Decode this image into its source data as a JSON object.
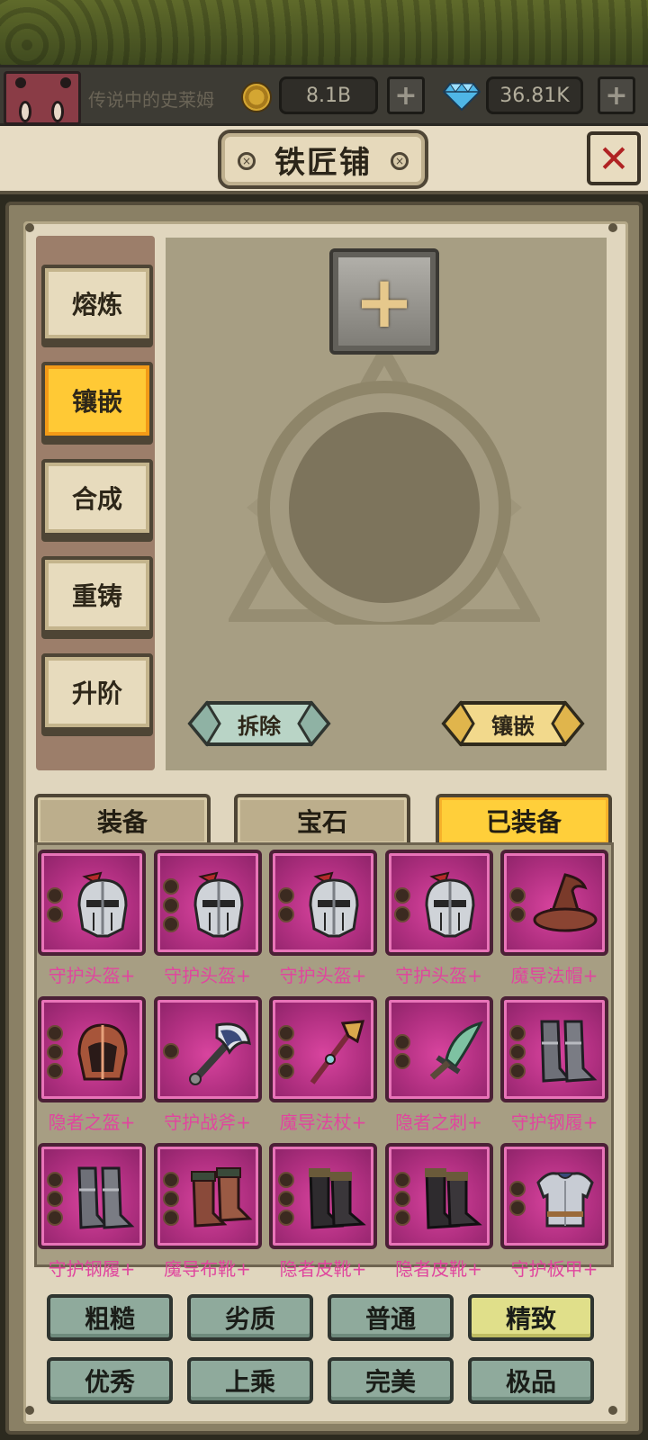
{
  "player": {
    "name": "传说中的史莱姆",
    "gold": "8.1B",
    "gems": "36.81K",
    "add_label": "+"
  },
  "header": {
    "title": "铁匠铺",
    "close_label": "✕"
  },
  "side_tabs": [
    {
      "label": "熔炼",
      "active": false
    },
    {
      "label": "镶嵌",
      "active": true
    },
    {
      "label": "合成",
      "active": false
    },
    {
      "label": "重铸",
      "active": false
    },
    {
      "label": "升阶",
      "active": false
    }
  ],
  "socket": {
    "add_slot_label": "+",
    "remove_button": "拆除",
    "inlay_button": "镶嵌"
  },
  "category_tabs": [
    {
      "label": "装备",
      "active": false
    },
    {
      "label": "宝石",
      "active": false
    },
    {
      "label": "已装备",
      "active": true
    }
  ],
  "items": [
    {
      "name": "守护头盔+",
      "icon": "helmet-icon",
      "sockets": 2
    },
    {
      "name": "守护头盔+",
      "icon": "helmet-icon",
      "sockets": 3
    },
    {
      "name": "守护头盔+",
      "icon": "helmet-icon",
      "sockets": 2
    },
    {
      "name": "守护头盔+",
      "icon": "helmet-icon",
      "sockets": 2
    },
    {
      "name": "魔导法帽+",
      "icon": "wizard-hat-icon",
      "sockets": 2
    },
    {
      "name": "隐者之盔+",
      "icon": "hood-helmet-icon",
      "sockets": 3
    },
    {
      "name": "守护战斧+",
      "icon": "battle-axe-icon",
      "sockets": 1
    },
    {
      "name": "魔导法杖+",
      "icon": "magic-staff-icon",
      "sockets": 3
    },
    {
      "name": "隐者之刺+",
      "icon": "dagger-icon",
      "sockets": 2
    },
    {
      "name": "守护钢履+",
      "icon": "steel-boots-icon",
      "sockets": 3
    },
    {
      "name": "守护钢履+",
      "icon": "steel-boots-icon",
      "sockets": 3
    },
    {
      "name": "魔导布靴+",
      "icon": "cloth-boots-icon",
      "sockets": 3
    },
    {
      "name": "隐者皮靴+",
      "icon": "leather-boots-icon",
      "sockets": 3
    },
    {
      "name": "隐者皮靴+",
      "icon": "leather-boots-icon",
      "sockets": 3
    },
    {
      "name": "守护板甲+",
      "icon": "plate-armor-icon",
      "sockets": 2
    }
  ],
  "quality_filters": [
    {
      "label": "粗糙",
      "active": false
    },
    {
      "label": "劣质",
      "active": false
    },
    {
      "label": "普通",
      "active": false
    },
    {
      "label": "精致",
      "active": true
    },
    {
      "label": "优秀",
      "active": false
    },
    {
      "label": "上乘",
      "active": false
    },
    {
      "label": "完美",
      "active": false
    },
    {
      "label": "极品",
      "active": false
    }
  ],
  "colors": {
    "item_frame": "#b02f80",
    "item_label": "#e0469e",
    "active_tab": "#ffc935",
    "filter_button": "#8faa9c",
    "filter_active": "#e0df8a"
  }
}
